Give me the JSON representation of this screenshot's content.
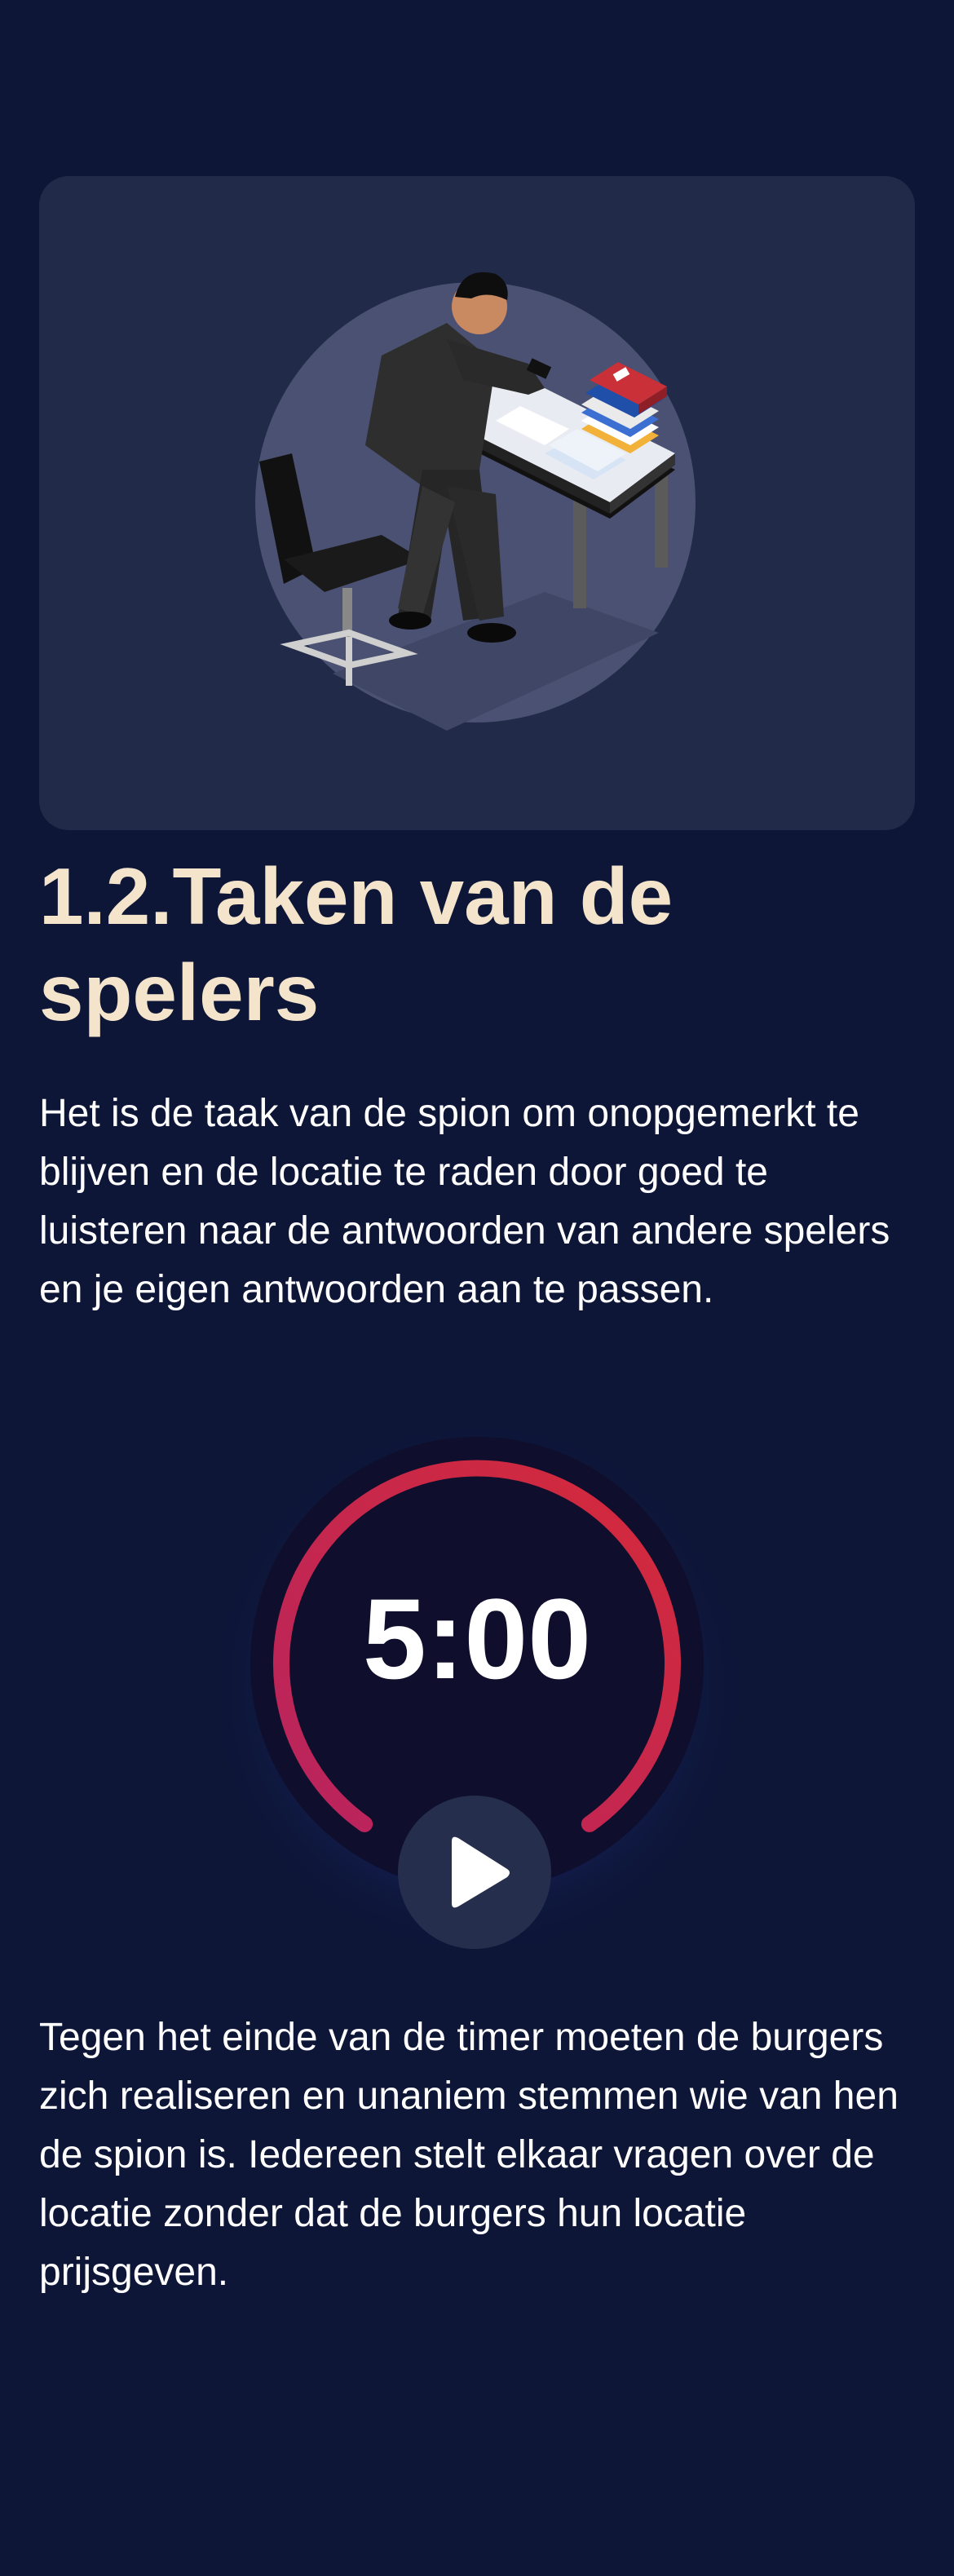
{
  "section": {
    "title": "1.2.Taken van de spelers",
    "paragraph_1": "Het is de taak van de spion om onopgemerkt te blijven en de locatie te raden door goed te luisteren naar de antwoorden van andere spelers en je eigen antwoorden aan te passen.",
    "paragraph_2": "Tegen het einde van de timer moeten de burgers zich realiseren en unaniem stemmen wie van hen de spion is. Iedereen stelt elkaar vragen over de locatie zonder dat de burgers hun locatie prijsgeven."
  },
  "timer": {
    "display": "5:00",
    "play_icon": "play-icon",
    "ring_color_start": "#c0245d",
    "ring_color_end": "#d42a3a"
  },
  "illustration": {
    "icon": "spy-at-desk-illustration",
    "card_color": "#212a48",
    "circle_color": "#4a5172"
  },
  "colors": {
    "background": "#0d1637",
    "title": "#f3e4cb",
    "text": "#ffffff"
  }
}
